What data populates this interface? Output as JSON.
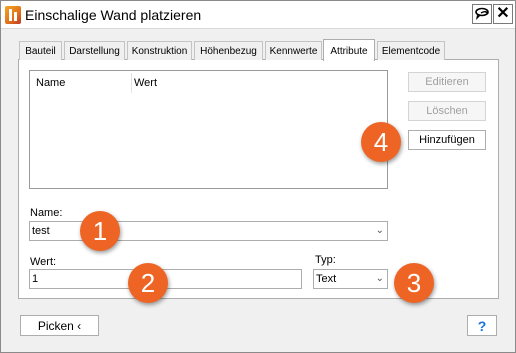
{
  "window": {
    "title": "Einschalige Wand platzieren",
    "close_label": "✕"
  },
  "tabs": [
    {
      "label": "Bauteil"
    },
    {
      "label": "Darstellung"
    },
    {
      "label": "Konstruktion"
    },
    {
      "label": "Höhenbezug"
    },
    {
      "label": "Kennwerte"
    },
    {
      "label": "Attribute",
      "active": true
    },
    {
      "label": "Elementcode"
    }
  ],
  "attributes_list": {
    "columns": [
      "Name",
      "Wert"
    ],
    "rows": []
  },
  "side_buttons": {
    "edit": "Editieren",
    "delete": "Löschen",
    "add": "Hinzufügen"
  },
  "form": {
    "name_label": "Name:",
    "name_value": "test",
    "value_label": "Wert:",
    "value_value": "1",
    "type_label": "Typ:",
    "type_value": "Text"
  },
  "badges": [
    "1",
    "2",
    "3",
    "4"
  ],
  "bottom": {
    "pick_label": "Picken ‹",
    "help_label": "?"
  },
  "colors": {
    "badge": "#ee6424",
    "help": "#1a73d9"
  }
}
